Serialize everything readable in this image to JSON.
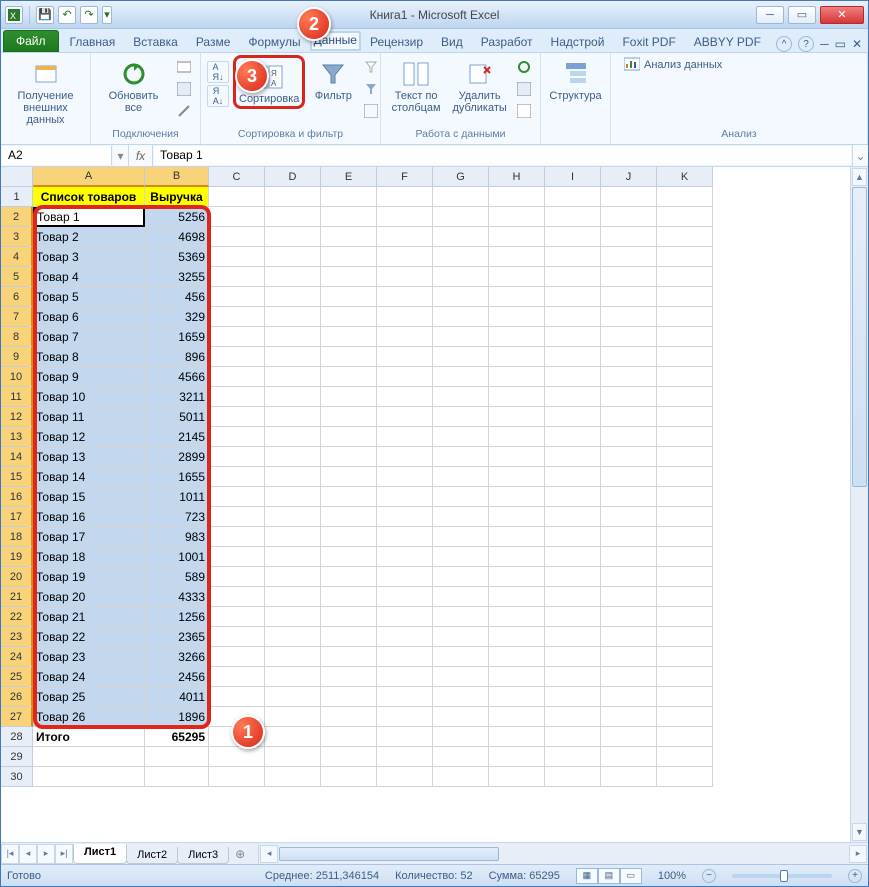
{
  "title": "Книга1  -  Microsoft Excel",
  "qat": {
    "save": "💾",
    "undo": "↶",
    "redo": "↷",
    "more": "▾"
  },
  "tabs": {
    "file": "Файл",
    "items": [
      "Главная",
      "Вставка",
      "Разме",
      "Формулы",
      "Данные",
      "Рецензир",
      "Вид",
      "Разработ",
      "Надстрой",
      "Foxit PDF",
      "ABBYY PDF"
    ]
  },
  "active_tab": "Данные",
  "ribbon": {
    "g1": {
      "label": "",
      "btn": {
        "label": "Получение внешних данных",
        "drop": "▾"
      }
    },
    "g2": {
      "label": "Подключения",
      "btn": {
        "label": "Обновить все",
        "drop": "▾"
      }
    },
    "g3": {
      "label": "Сортировка и фильтр",
      "sortasc": "А↓Я",
      "sortdesc": "Я↓А",
      "sort": "Сортировка",
      "filter": "Фильтр"
    },
    "g4": {
      "label": "Работа с данными",
      "texttocol": "Текст по столбцам",
      "removedup": "Удалить дубликаты"
    },
    "g5": {
      "label": "",
      "btn": "Структура",
      "drop": "▾"
    },
    "g6": {
      "label": "Анализ",
      "btn": "Анализ данных"
    }
  },
  "namebox": "A2",
  "fx": "fx",
  "formula": "Товар 1",
  "columns": [
    "A",
    "B",
    "C",
    "D",
    "E",
    "F",
    "G",
    "H",
    "I",
    "J",
    "K"
  ],
  "headers": {
    "A": "Список товаров",
    "B": "Выручка"
  },
  "rows": [
    {
      "n": 1,
      "A": "Список товаров",
      "B": "Выручка",
      "hdr": true
    },
    {
      "n": 2,
      "A": "Товар 1",
      "B": "5256",
      "sel": true,
      "active": true
    },
    {
      "n": 3,
      "A": "Товар 2",
      "B": "4698",
      "sel": true
    },
    {
      "n": 4,
      "A": "Товар 3",
      "B": "5369",
      "sel": true
    },
    {
      "n": 5,
      "A": "Товар 4",
      "B": "3255",
      "sel": true
    },
    {
      "n": 6,
      "A": "Товар 5",
      "B": "456",
      "sel": true
    },
    {
      "n": 7,
      "A": "Товар 6",
      "B": "329",
      "sel": true
    },
    {
      "n": 8,
      "A": "Товар 7",
      "B": "1659",
      "sel": true
    },
    {
      "n": 9,
      "A": "Товар 8",
      "B": "896",
      "sel": true
    },
    {
      "n": 10,
      "A": "Товар 9",
      "B": "4566",
      "sel": true
    },
    {
      "n": 11,
      "A": "Товар 10",
      "B": "3211",
      "sel": true
    },
    {
      "n": 12,
      "A": "Товар 11",
      "B": "5011",
      "sel": true
    },
    {
      "n": 13,
      "A": "Товар 12",
      "B": "2145",
      "sel": true
    },
    {
      "n": 14,
      "A": "Товар 13",
      "B": "2899",
      "sel": true
    },
    {
      "n": 15,
      "A": "Товар 14",
      "B": "1655",
      "sel": true
    },
    {
      "n": 16,
      "A": "Товар 15",
      "B": "1011",
      "sel": true
    },
    {
      "n": 17,
      "A": "Товар 16",
      "B": "723",
      "sel": true
    },
    {
      "n": 18,
      "A": "Товар 17",
      "B": "983",
      "sel": true
    },
    {
      "n": 19,
      "A": "Товар 18",
      "B": "1001",
      "sel": true
    },
    {
      "n": 20,
      "A": "Товар 19",
      "B": "589",
      "sel": true
    },
    {
      "n": 21,
      "A": "Товар 20",
      "B": "4333",
      "sel": true
    },
    {
      "n": 22,
      "A": "Товар 21",
      "B": "1256",
      "sel": true
    },
    {
      "n": 23,
      "A": "Товар 22",
      "B": "2365",
      "sel": true
    },
    {
      "n": 24,
      "A": "Товар 23",
      "B": "3266",
      "sel": true
    },
    {
      "n": 25,
      "A": "Товар 24",
      "B": "2456",
      "sel": true
    },
    {
      "n": 26,
      "A": "Товар 25",
      "B": "4011",
      "sel": true
    },
    {
      "n": 27,
      "A": "Товар 26",
      "B": "1896",
      "sel": true
    },
    {
      "n": 28,
      "A": "Итого",
      "B": "65295",
      "total": true
    },
    {
      "n": 29,
      "A": "",
      "B": ""
    },
    {
      "n": 30,
      "A": "",
      "B": ""
    }
  ],
  "sheets": [
    "Лист1",
    "Лист2",
    "Лист3"
  ],
  "active_sheet": "Лист1",
  "status": {
    "ready": "Готово",
    "avg_label": "Среднее:",
    "avg": "2511,346154",
    "count_label": "Количество:",
    "count": "52",
    "sum_label": "Сумма:",
    "sum": "65295",
    "zoom": "100%"
  },
  "callouts": {
    "1": "1",
    "2": "2",
    "3": "3"
  }
}
